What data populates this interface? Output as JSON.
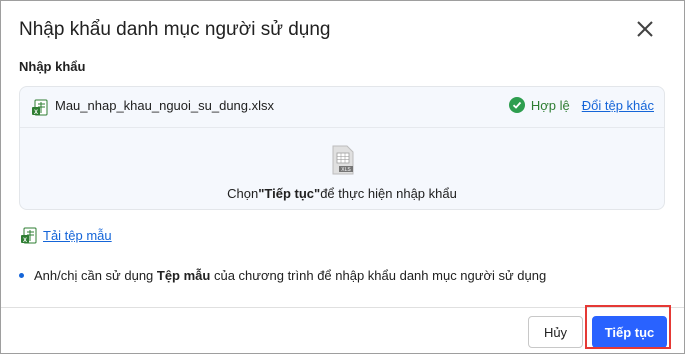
{
  "dialog": {
    "title": "Nhập khẩu danh mục người sử dụng",
    "close_icon": "close-icon"
  },
  "import_section": {
    "label": "Nhập khẩu",
    "file_name": "Mau_nhap_khau_nguoi_su_dung.xlsx",
    "status": "Hợp lệ",
    "change_file": "Đổi tệp khác",
    "hint_prefix": "Chọn",
    "hint_emphasis": "\"Tiếp tục\"",
    "hint_suffix": "để thực hiện nhập khẩu",
    "status_color": "#2e7d32"
  },
  "template": {
    "download_label": "Tải tệp mẫu"
  },
  "note": {
    "prefix": "Anh/chị cần sử dụng ",
    "emphasis": "Tệp mẫu",
    "suffix": " của chương trình để nhập khẩu danh mục người sử dụng"
  },
  "footer": {
    "cancel_label": "Hủy",
    "next_label": "Tiếp tục",
    "primary_color": "#2962ff"
  }
}
